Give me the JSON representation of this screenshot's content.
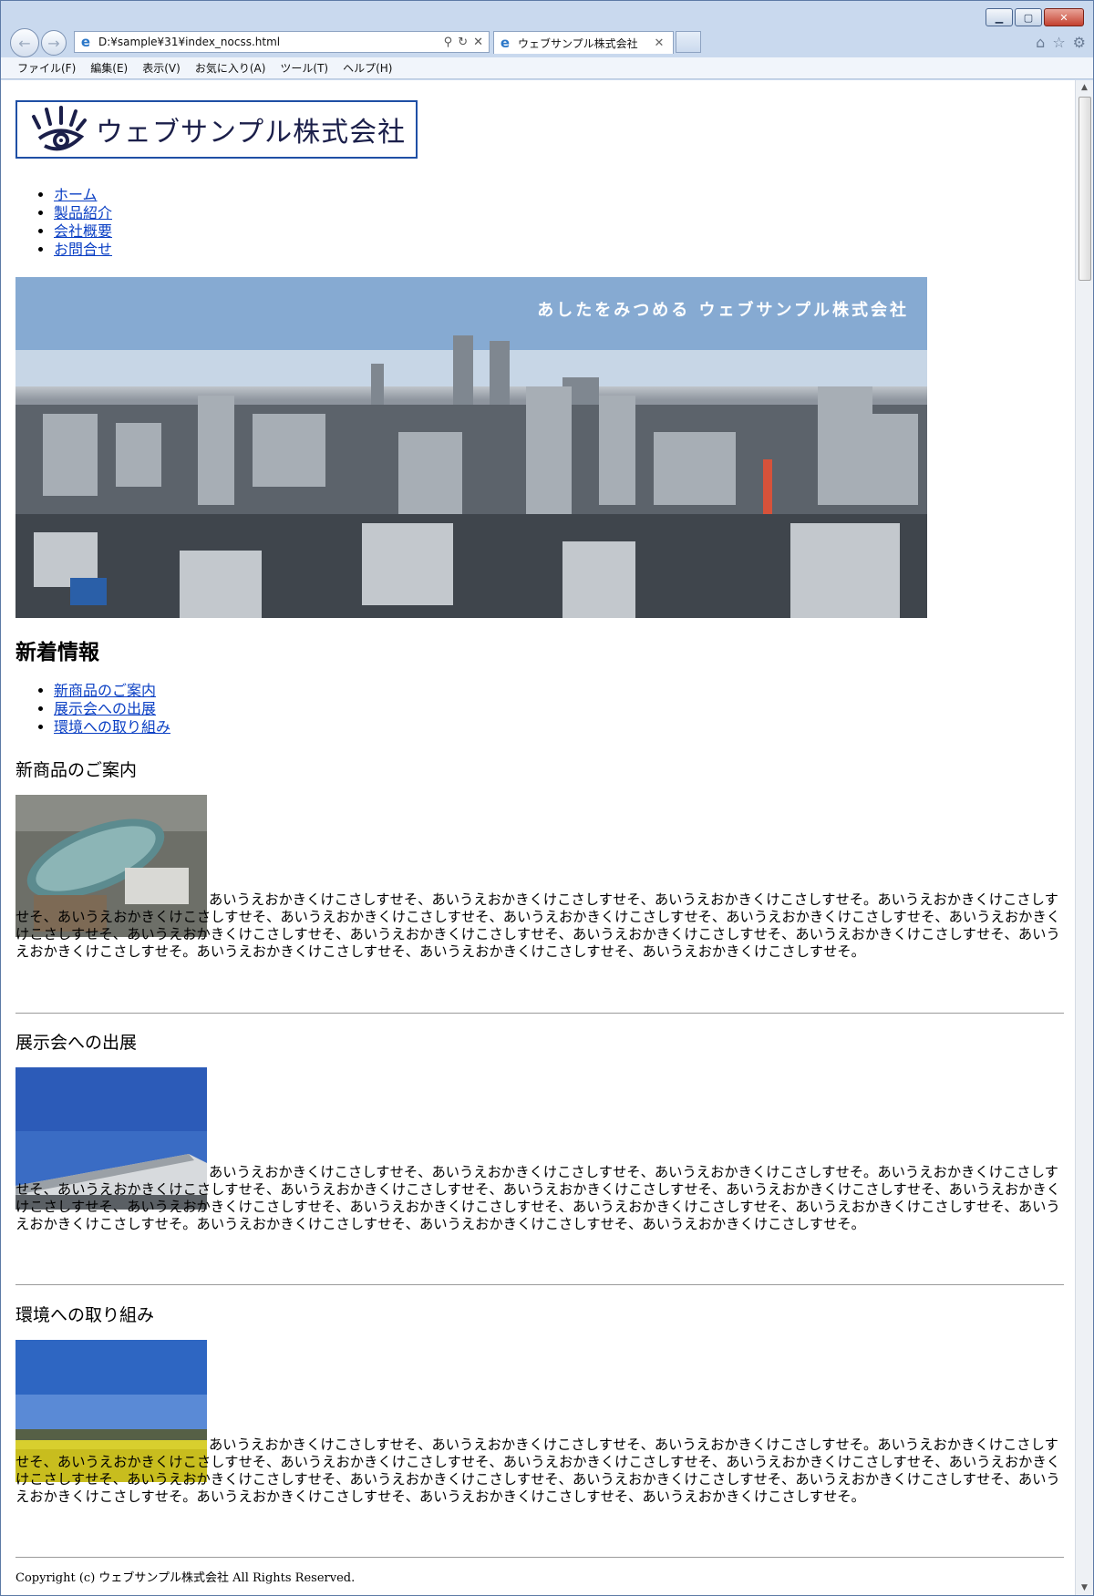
{
  "window": {
    "buttons": {
      "minimize": "▁",
      "maximize": "▢",
      "close": "✕"
    }
  },
  "browser": {
    "address": "D:¥sample¥31¥index_nocss.html",
    "tab_title": "ウェブサンプル株式会社",
    "icons": [
      "back-icon",
      "forward-icon",
      "search-icon",
      "refresh-icon",
      "stop-icon",
      "home-icon",
      "favorites-icon",
      "settings-icon"
    ]
  },
  "menu": {
    "items": [
      {
        "label": "ファイル(F)"
      },
      {
        "label": "編集(E)"
      },
      {
        "label": "表示(V)"
      },
      {
        "label": "お気に入り(A)"
      },
      {
        "label": "ツール(T)"
      },
      {
        "label": "ヘルプ(H)"
      }
    ]
  },
  "site": {
    "logo_text": "ウェブサンプル株式会社",
    "nav": [
      {
        "label": "ホーム"
      },
      {
        "label": "製品紹介"
      },
      {
        "label": "会社概要"
      },
      {
        "label": "お問合せ"
      }
    ],
    "hero_text": "あしたをみつめる ウェブサンプル株式会社",
    "news_title": "新着情報",
    "news_links": [
      {
        "label": "新商品のご案内"
      },
      {
        "label": "展示会への出展"
      },
      {
        "label": "環境への取り組み"
      }
    ],
    "articles": [
      {
        "title": "新商品のご案内",
        "body": "あいうえおかきくけこさしすせそ、あいうえおかきくけこさしすせそ、あいうえおかきくけこさしすせそ。あいうえおかきくけこさしすせそ、あいうえおかきくけこさしすせそ、あいうえおかきくけこさしすせそ、あいうえおかきくけこさしすせそ、あいうえおかきくけこさしすせそ、あいうえおかきくけこさしすせそ、あいうえおかきくけこさしすせそ、あいうえおかきくけこさしすせそ、あいうえおかきくけこさしすせそ、あいうえおかきくけこさしすせそ、あいうえおかきくけこさしすせそ。あいうえおかきくけこさしすせそ、あいうえおかきくけこさしすせそ、あいうえおかきくけこさしすせそ。"
      },
      {
        "title": "展示会への出展",
        "body": "あいうえおかきくけこさしすせそ、あいうえおかきくけこさしすせそ、あいうえおかきくけこさしすせそ。あいうえおかきくけこさしすせそ、あいうえおかきくけこさしすせそ、あいうえおかきくけこさしすせそ、あいうえおかきくけこさしすせそ、あいうえおかきくけこさしすせそ、あいうえおかきくけこさしすせそ、あいうえおかきくけこさしすせそ、あいうえおかきくけこさしすせそ、あいうえおかきくけこさしすせそ、あいうえおかきくけこさしすせそ、あいうえおかきくけこさしすせそ。あいうえおかきくけこさしすせそ、あいうえおかきくけこさしすせそ、あいうえおかきくけこさしすせそ。"
      },
      {
        "title": "環境への取り組み",
        "body": "あいうえおかきくけこさしすせそ、あいうえおかきくけこさしすせそ、あいうえおかきくけこさしすせそ。あいうえおかきくけこさしすせそ、あいうえおかきくけこさしすせそ、あいうえおかきくけこさしすせそ、あいうえおかきくけこさしすせそ、あいうえおかきくけこさしすせそ、あいうえおかきくけこさしすせそ、あいうえおかきくけこさしすせそ、あいうえおかきくけこさしすせそ、あいうえおかきくけこさしすせそ、あいうえおかきくけこさしすせそ、あいうえおかきくけこさしすせそ。あいうえおかきくけこさしすせそ、あいうえおかきくけこさしすせそ、あいうえおかきくけこさしすせそ。"
      }
    ],
    "footer": "Copyright (c) ウェブサンプル株式会社 All Rights Reserved."
  },
  "colors": {
    "link": "#0a3fc4",
    "logo_border": "#1f4fa5",
    "logo_text": "#1b1f4a"
  }
}
